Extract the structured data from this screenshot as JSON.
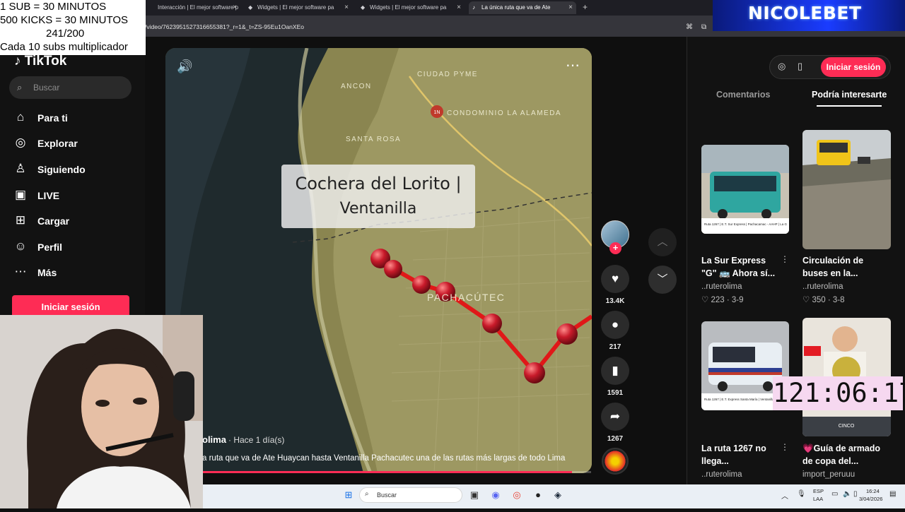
{
  "overlay": {
    "line1": "1 SUB      = 30 MINUTOS",
    "line2": "500 KICKS = 30 MINUTOS",
    "line3": "241/200",
    "line4": "Cada 10 subs multiplicador",
    "brand": "NICOLEBET",
    "timer": "121:06:17"
  },
  "browser": {
    "tabs": [
      {
        "label": "Interacción | El mejor software p"
      },
      {
        "label": "Widgets | El mejor software pa"
      },
      {
        "label": "Widgets | El mejor software pa"
      },
      {
        "label": "La única ruta que va de Ate"
      }
    ],
    "url": "/video/7623951527316655381?_r=1&_t=ZS-95Eu1OanXEo"
  },
  "sidebar": {
    "logo": "TikTok",
    "search_placeholder": "Buscar",
    "items": [
      {
        "label": "Para ti",
        "icon": "home-icon"
      },
      {
        "label": "Explorar",
        "icon": "compass-icon"
      },
      {
        "label": "Siguiendo",
        "icon": "following-icon"
      },
      {
        "label": "LIVE",
        "icon": "live-icon"
      },
      {
        "label": "Cargar",
        "icon": "upload-icon"
      },
      {
        "label": "Perfil",
        "icon": "profile-icon"
      },
      {
        "label": "Más",
        "icon": "more-icon"
      }
    ],
    "login": "Iniciar sesión"
  },
  "video": {
    "caption_line1": "Cochera del Lorito |",
    "caption_line2": "Ventanilla",
    "author": "olima",
    "ago": "· Hace 1 día(s)",
    "description": "a ruta que va de Ate Huaycan hasta Ventanilla Pachacutec una de las rutas más largas de todo Lima",
    "progress": 0.95,
    "map_labels": [
      "ANCON",
      "CIUDAD PYME",
      "SANTA ROSA",
      "CONDOMINIO LA ALAMEDA",
      "PACHACÚTEC",
      "1N"
    ]
  },
  "actions": {
    "likes": "13.4K",
    "comments": "217",
    "saves": "1591",
    "shares": "1267"
  },
  "panel": {
    "login": "Iniciar sesión",
    "tab_comments": "Comentarios",
    "tab_related": "Podría interesarte",
    "cards": [
      {
        "title": "La Sur Express \"G\" 🚌 Ahora sí...",
        "author": "..ruterolima",
        "stats": "♡ 223 · 3-9"
      },
      {
        "title": "Circulación de buses en la...",
        "author": "..ruterolima",
        "stats": "♡ 350 · 3-8"
      },
      {
        "title": "La ruta 1267 no llega...",
        "author": "..ruterolima",
        "stats": ""
      },
      {
        "title": "💗Guía de armado de copa del...",
        "author": "import_peruuu",
        "stats": ""
      }
    ],
    "thumb_text_1": "Ruta 1267 | E.T. Sur Express | Pachacamac - AAHP | La G",
    "thumb_text_3": "Ruta 1267 | E.T. Express Santa María | Ventanilla - Ate",
    "thumb_text_4": "CINCO"
  },
  "taskbar": {
    "search": "Buscar",
    "lang1": "ESP",
    "lang2": "LAA",
    "time": "16:24",
    "date": "3/04/2026"
  },
  "colors": {
    "accent": "#fe2c55",
    "route": "#e01818"
  }
}
